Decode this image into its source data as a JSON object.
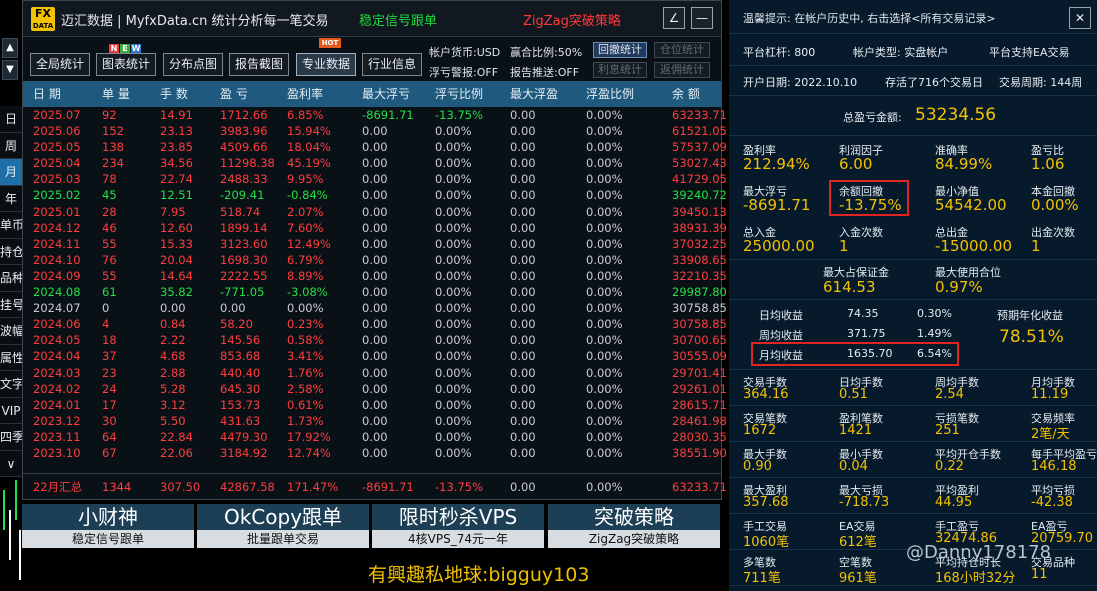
{
  "left_strip": {
    "up_label": "▲",
    "down_label": "▼",
    "period_tabs": [
      "日",
      "周",
      "月",
      "年",
      "单币",
      "持仓",
      "品种",
      "挂号",
      "波幅",
      "属性",
      "文字",
      "VIP",
      "四季",
      "∨"
    ],
    "active_tab_index": 2
  },
  "header": {
    "logo_top": "FX",
    "logo_bottom": "DATA",
    "title": "迈汇数据 | MyfxData.cn   统计分析每一笔交易",
    "link_signal": "稳定信号跟单",
    "link_zigzag": "ZigZag突破策略",
    "edit_icon": "∠",
    "minimize_icon": "—"
  },
  "toolbar": {
    "buttons": [
      "全局统计",
      "图表统计",
      "分布点图",
      "报告截图",
      "专业数据",
      "行业信息"
    ],
    "active_index": 4,
    "new_badge": [
      "N",
      "E",
      "W"
    ],
    "hot_badge": "HOT",
    "currency": "帐户货币:USD",
    "ratio": "赢合比例:50%",
    "float_alert": "浮亏警报:OFF",
    "report_push": "报告推送:OFF",
    "small_buttons": [
      "回撤统计",
      "仓位统计",
      "利息统计",
      "返佣统计"
    ]
  },
  "table": {
    "headers": [
      "日 期",
      "单 量",
      "手 数",
      "盈 亏",
      "盈利率",
      "最大浮亏",
      "浮亏比例",
      "最大浮盈",
      "浮盈比例",
      "余 额"
    ],
    "rows": [
      {
        "cells": [
          "2025.07",
          "92",
          "14.91",
          "1712.66",
          "6.85%",
          "-8691.71",
          "-13.75%",
          "0.00",
          "0.00%",
          "63233.71"
        ],
        "color": "red",
        "float_color": "green"
      },
      {
        "cells": [
          "2025.06",
          "152",
          "23.13",
          "3983.96",
          "15.94%",
          "0.00",
          "0.00%",
          "0.00",
          "0.00%",
          "61521.05"
        ],
        "color": "red"
      },
      {
        "cells": [
          "2025.05",
          "138",
          "23.85",
          "4509.66",
          "18.04%",
          "0.00",
          "0.00%",
          "0.00",
          "0.00%",
          "57537.09"
        ],
        "color": "red"
      },
      {
        "cells": [
          "2025.04",
          "234",
          "34.56",
          "11298.38",
          "45.19%",
          "0.00",
          "0.00%",
          "0.00",
          "0.00%",
          "53027.43"
        ],
        "color": "red"
      },
      {
        "cells": [
          "2025.03",
          "78",
          "22.74",
          "2488.33",
          "9.95%",
          "0.00",
          "0.00%",
          "0.00",
          "0.00%",
          "41729.05"
        ],
        "color": "red"
      },
      {
        "cells": [
          "2025.02",
          "45",
          "12.51",
          "-209.41",
          "-0.84%",
          "0.00",
          "0.00%",
          "0.00",
          "0.00%",
          "39240.72"
        ],
        "color": "green"
      },
      {
        "cells": [
          "2025.01",
          "28",
          "7.95",
          "518.74",
          "2.07%",
          "0.00",
          "0.00%",
          "0.00",
          "0.00%",
          "39450.13"
        ],
        "color": "red"
      },
      {
        "cells": [
          "2024.12",
          "46",
          "12.60",
          "1899.14",
          "7.60%",
          "0.00",
          "0.00%",
          "0.00",
          "0.00%",
          "38931.39"
        ],
        "color": "red"
      },
      {
        "cells": [
          "2024.11",
          "55",
          "15.33",
          "3123.60",
          "12.49%",
          "0.00",
          "0.00%",
          "0.00",
          "0.00%",
          "37032.25"
        ],
        "color": "red"
      },
      {
        "cells": [
          "2024.10",
          "76",
          "20.04",
          "1698.30",
          "6.79%",
          "0.00",
          "0.00%",
          "0.00",
          "0.00%",
          "33908.65"
        ],
        "color": "red"
      },
      {
        "cells": [
          "2024.09",
          "55",
          "14.64",
          "2222.55",
          "8.89%",
          "0.00",
          "0.00%",
          "0.00",
          "0.00%",
          "32210.35"
        ],
        "color": "red"
      },
      {
        "cells": [
          "2024.08",
          "61",
          "35.82",
          "-771.05",
          "-3.08%",
          "0.00",
          "0.00%",
          "0.00",
          "0.00%",
          "29987.80"
        ],
        "color": "green"
      },
      {
        "cells": [
          "2024.07",
          "0",
          "0.00",
          "0.00",
          "0.00%",
          "0.00",
          "0.00%",
          "0.00",
          "0.00%",
          "30758.85"
        ],
        "color": "gray"
      },
      {
        "cells": [
          "2024.06",
          "4",
          "0.84",
          "58.20",
          "0.23%",
          "0.00",
          "0.00%",
          "0.00",
          "0.00%",
          "30758.85"
        ],
        "color": "red"
      },
      {
        "cells": [
          "2024.05",
          "18",
          "2.22",
          "145.56",
          "0.58%",
          "0.00",
          "0.00%",
          "0.00",
          "0.00%",
          "30700.65"
        ],
        "color": "red"
      },
      {
        "cells": [
          "2024.04",
          "37",
          "4.68",
          "853.68",
          "3.41%",
          "0.00",
          "0.00%",
          "0.00",
          "0.00%",
          "30555.09"
        ],
        "color": "red"
      },
      {
        "cells": [
          "2024.03",
          "23",
          "2.88",
          "440.40",
          "1.76%",
          "0.00",
          "0.00%",
          "0.00",
          "0.00%",
          "29701.41"
        ],
        "color": "red"
      },
      {
        "cells": [
          "2024.02",
          "24",
          "5.28",
          "645.30",
          "2.58%",
          "0.00",
          "0.00%",
          "0.00",
          "0.00%",
          "29261.01"
        ],
        "color": "red"
      },
      {
        "cells": [
          "2024.01",
          "17",
          "3.12",
          "153.73",
          "0.61%",
          "0.00",
          "0.00%",
          "0.00",
          "0.00%",
          "28615.71"
        ],
        "color": "red"
      },
      {
        "cells": [
          "2023.12",
          "30",
          "5.50",
          "431.63",
          "1.73%",
          "0.00",
          "0.00%",
          "0.00",
          "0.00%",
          "28461.98"
        ],
        "color": "red"
      },
      {
        "cells": [
          "2023.11",
          "64",
          "22.84",
          "4479.30",
          "17.92%",
          "0.00",
          "0.00%",
          "0.00",
          "0.00%",
          "28030.35"
        ],
        "color": "red"
      },
      {
        "cells": [
          "2023.10",
          "67",
          "22.06",
          "3184.92",
          "12.74%",
          "0.00",
          "0.00%",
          "0.00",
          "0.00%",
          "38551.90"
        ],
        "color": "red"
      }
    ],
    "summary": [
      "22月汇总",
      "1344",
      "307.50",
      "42867.58",
      "171.47%",
      "-8691.71",
      "-13.75%",
      "0.00",
      "0.00%",
      "63233.71"
    ]
  },
  "promos": [
    {
      "title": "小财神",
      "sub": "稳定信号跟单"
    },
    {
      "title": "OkCopy跟单",
      "sub": "批量跟单交易"
    },
    {
      "title": "限时秒杀VPS",
      "sub": "4核VPS_74元一年"
    },
    {
      "title": "突破策略",
      "sub": "ZigZag突破策略"
    }
  ],
  "bottom_text": "有興趣私地球:bigguy103",
  "watermark": "@Danny178178",
  "right": {
    "tip": "温馨提示: 在帐户历史中, 右击选择<所有交易记录>",
    "close_icon": "✕",
    "leverage": "平台杠杆: 800",
    "account_type": "帐户类型: 实盘帐户",
    "ea_support": "平台支持EA交易",
    "open_date": "开户日期: 2022.10.10",
    "survived": "存活了716个交易日",
    "trade_cycle": "交易周期: 144周",
    "total_pl_label": "总盈亏金额:",
    "total_pl_value": "53234.56",
    "metrics1": [
      {
        "label": "盈利率",
        "value": "212.94%"
      },
      {
        "label": "利润因子",
        "value": "6.00"
      },
      {
        "label": "准确率",
        "value": "84.99%"
      },
      {
        "label": "盈亏比",
        "value": "1.06"
      }
    ],
    "metrics2": [
      {
        "label": "最大浮亏",
        "value": "-8691.71"
      },
      {
        "label": "余额回撤",
        "value": "-13.75%"
      },
      {
        "label": "最小净值",
        "value": "54542.00"
      },
      {
        "label": "本金回撤",
        "value": "0.00%"
      }
    ],
    "metrics3": [
      {
        "label": "总入金",
        "value": "25000.00"
      },
      {
        "label": "入金次数",
        "value": "1"
      },
      {
        "label": "总出金",
        "value": "-15000.00"
      },
      {
        "label": "出金次数",
        "value": "1"
      }
    ],
    "margin": [
      {
        "label": "最大占保证金",
        "value": "614.53"
      },
      {
        "label": "最大使用合位",
        "value": "0.97%"
      }
    ],
    "returns": [
      {
        "label": "日均收益",
        "amount": "74.35",
        "pct": "0.30%"
      },
      {
        "label": "周均收益",
        "amount": "371.75",
        "pct": "1.49%"
      },
      {
        "label": "月均收益",
        "amount": "1635.70",
        "pct": "6.54%"
      }
    ],
    "annual_label": "预期年化收益",
    "annual_value": "78.51%",
    "grid": [
      [
        {
          "label": "交易手数",
          "value": "364.16"
        },
        {
          "label": "日均手数",
          "value": "0.51"
        },
        {
          "label": "周均手数",
          "value": "2.54"
        },
        {
          "label": "月均手数",
          "value": "11.19"
        }
      ],
      [
        {
          "label": "交易笔数",
          "value": "1672"
        },
        {
          "label": "盈利笔数",
          "value": "1421"
        },
        {
          "label": "亏损笔数",
          "value": "251"
        },
        {
          "label": "交易频率",
          "value": "2笔/天"
        }
      ],
      [
        {
          "label": "最大手数",
          "value": "0.90"
        },
        {
          "label": "最小手数",
          "value": "0.04"
        },
        {
          "label": "平均开仓手数",
          "value": "0.22"
        },
        {
          "label": "每手平均盈亏",
          "value": "146.18"
        }
      ],
      [
        {
          "label": "最大盈利",
          "value": "357.68"
        },
        {
          "label": "最大亏损",
          "value": "-718.73"
        },
        {
          "label": "平均盈利",
          "value": "44.95"
        },
        {
          "label": "平均亏损",
          "value": "-42.38"
        }
      ],
      [
        {
          "label": "手工交易",
          "value": "1060笔"
        },
        {
          "label": "EA交易",
          "value": "612笔"
        },
        {
          "label": "手工盈亏",
          "value": "32474.86"
        },
        {
          "label": "EA盈亏",
          "value": "20759.70"
        }
      ],
      [
        {
          "label": "多笔数",
          "value": "711笔"
        },
        {
          "label": "空笔数",
          "value": "961笔"
        },
        {
          "label": "平均持仓时长",
          "value": "168小时32分"
        },
        {
          "label": "交易品种",
          "value": "11"
        }
      ]
    ]
  }
}
